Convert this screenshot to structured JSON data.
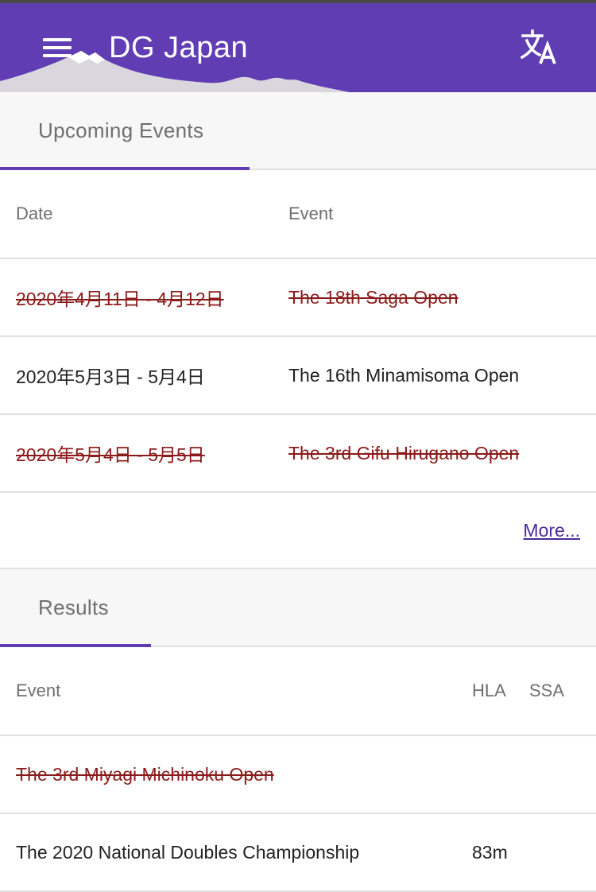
{
  "app": {
    "title": "DG Japan",
    "colors": {
      "primary": "#613db4",
      "cancelled": "#8b1a1a",
      "link": "#4a2a9c"
    },
    "icons": {
      "menu": "hamburger-menu-icon",
      "translate": "translate-icon",
      "decoration": "mount-fuji-decoration"
    }
  },
  "upcoming": {
    "tab_label": "Upcoming Events",
    "columns": {
      "date": "Date",
      "event": "Event"
    },
    "rows": [
      {
        "date": "2020年4月11日 - 4月12日",
        "event": "The 18th Saga Open",
        "cancelled": true
      },
      {
        "date": "2020年5月3日 - 5月4日",
        "event": "The 16th Minamisoma Open",
        "cancelled": false
      },
      {
        "date": "2020年5月4日 - 5月5日",
        "event": "The 3rd Gifu Hirugano Open",
        "cancelled": true
      }
    ],
    "more_label": "More..."
  },
  "results": {
    "tab_label": "Results",
    "columns": {
      "event": "Event",
      "hla": "HLA",
      "ssa": "SSA"
    },
    "rows": [
      {
        "event": "The 3rd Miyagi Michinoku Open",
        "hla": "",
        "ssa": "",
        "cancelled": true
      },
      {
        "event": "The 2020 National Doubles Championship",
        "hla": "83m",
        "ssa": "",
        "cancelled": false
      }
    ]
  }
}
